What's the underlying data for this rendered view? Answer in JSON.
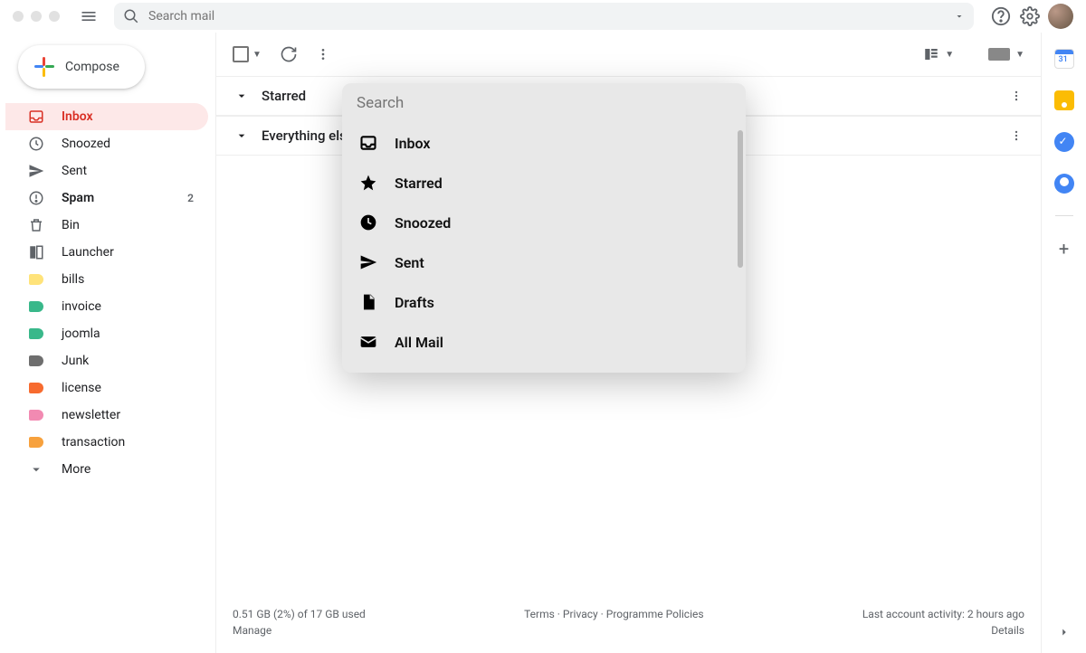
{
  "search": {
    "placeholder": "Search mail"
  },
  "compose": {
    "label": "Compose"
  },
  "sidebar": {
    "items": [
      {
        "label": "Inbox",
        "icon": "inbox",
        "selected": true
      },
      {
        "label": "Snoozed",
        "icon": "clock"
      },
      {
        "label": "Sent",
        "icon": "send"
      },
      {
        "label": "Spam",
        "icon": "spam",
        "bold": true,
        "count": "2"
      },
      {
        "label": "Bin",
        "icon": "trash"
      },
      {
        "label": "Launcher",
        "icon": "launcher"
      },
      {
        "label": "bills",
        "icon": "label",
        "color": "#ffe37a"
      },
      {
        "label": "invoice",
        "icon": "label",
        "color": "#39b88a"
      },
      {
        "label": "joomla",
        "icon": "label",
        "color": "#39b88a"
      },
      {
        "label": "Junk",
        "icon": "label",
        "color": "#6e6e6e"
      },
      {
        "label": "license",
        "icon": "label",
        "color": "#f76b2f"
      },
      {
        "label": "newsletter",
        "icon": "label",
        "color": "#f28ab2"
      },
      {
        "label": "transaction",
        "icon": "label",
        "color": "#f7a13d"
      },
      {
        "label": "More",
        "icon": "chevron"
      }
    ]
  },
  "sections": [
    {
      "label": "Starred"
    },
    {
      "label": "Everything else"
    }
  ],
  "popup": {
    "search_placeholder": "Search",
    "items": [
      {
        "label": "Inbox",
        "icon": "inbox"
      },
      {
        "label": "Starred",
        "icon": "star"
      },
      {
        "label": "Snoozed",
        "icon": "clock"
      },
      {
        "label": "Sent",
        "icon": "send"
      },
      {
        "label": "Drafts",
        "icon": "draft"
      },
      {
        "label": "All Mail",
        "icon": "mail"
      }
    ]
  },
  "footer": {
    "storage": "0.51 GB (2%) of 17 GB used",
    "manage": "Manage",
    "terms": "Terms",
    "privacy": "Privacy",
    "policies": "Programme Policies",
    "activity": "Last account activity: 2 hours ago",
    "details": "Details"
  }
}
